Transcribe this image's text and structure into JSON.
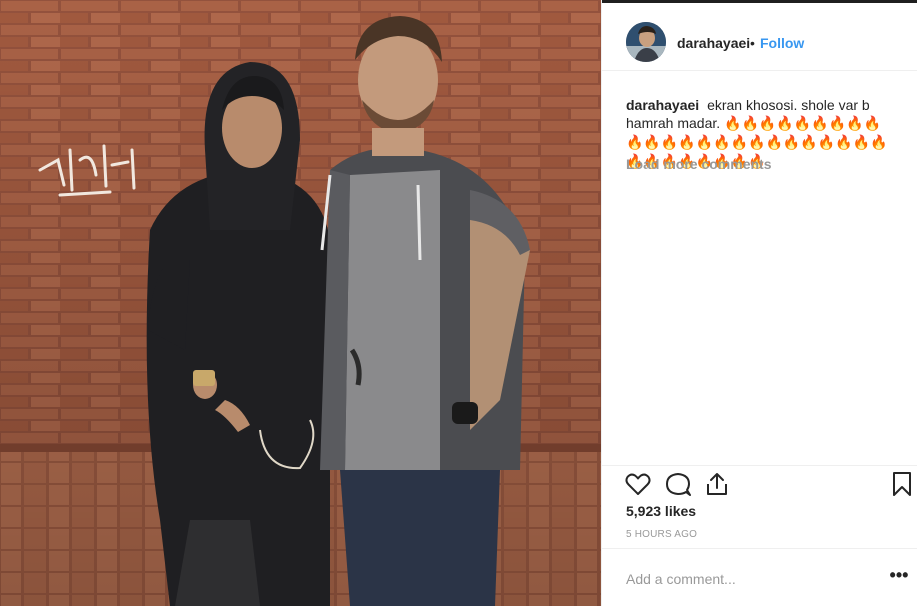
{
  "post": {
    "username": "darahayaei",
    "separator": "•",
    "follow_label": "Follow",
    "caption_user": "darahayaei",
    "caption_text": "ekran khososi. shole var b hamrah madar.",
    "caption_emojis": "🔥🔥🔥🔥🔥🔥🔥🔥🔥🔥🔥🔥🔥🔥🔥🔥🔥🔥🔥🔥🔥🔥🔥🔥🔥🔥🔥🔥🔥🔥🔥🔥",
    "load_more": "Load more comments",
    "likes": "5,923 likes",
    "time": "5 HOURS AGO",
    "comment_placeholder": "Add a comment...",
    "more_label": "•••"
  },
  "icons": {
    "like": "heart-icon",
    "comment": "comment-bubble-icon",
    "share": "share-icon",
    "save": "bookmark-icon",
    "more": "more-options-icon"
  },
  "colors": {
    "link": "#3897f0",
    "muted": "#999999",
    "text": "#262626",
    "divider": "#efefef"
  }
}
